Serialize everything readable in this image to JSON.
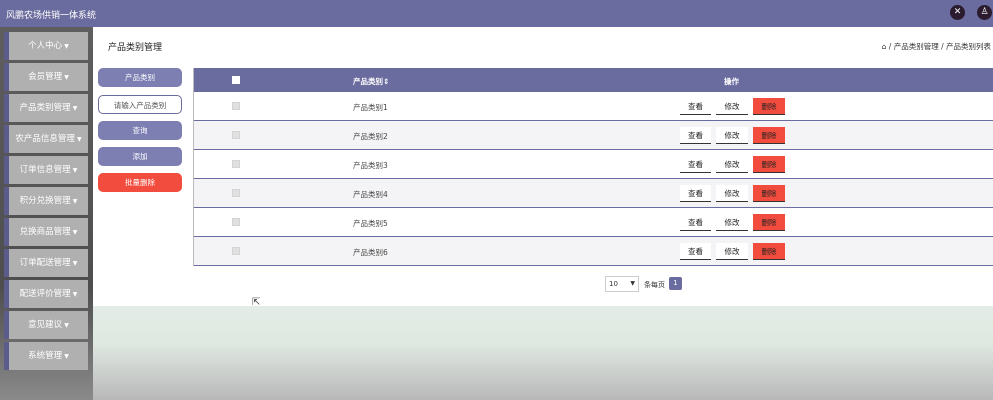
{
  "app": {
    "title": "风鹏农场供销一体系统"
  },
  "topbar": {
    "icons": [
      "fullscreen-exit-icon",
      "user-icon"
    ]
  },
  "sidebar": {
    "items": [
      {
        "label": "个人中心"
      },
      {
        "label": "会员管理"
      },
      {
        "label": "产品类别管理"
      },
      {
        "label": "农产品信息管理"
      },
      {
        "label": "订单信息管理"
      },
      {
        "label": "积分兑换管理"
      },
      {
        "label": "兑换商品管理"
      },
      {
        "label": "订单配送管理"
      },
      {
        "label": "配送评价管理"
      },
      {
        "label": "意见建议"
      },
      {
        "label": "系统管理"
      }
    ]
  },
  "header": {
    "title": "产品类别管理",
    "breadcrumb": "⌂ / 产品类别管理 / 产品类别列表"
  },
  "actions": {
    "field_label": "产品类别",
    "search_placeholder": "请输入产品类别",
    "query_label": "查询",
    "add_label": "添加",
    "batch_delete_label": "批量删除"
  },
  "table": {
    "columns": {
      "name": "产品类别⇕",
      "ops": "操作"
    },
    "rows": [
      {
        "name": "产品类别1"
      },
      {
        "name": "产品类别2"
      },
      {
        "name": "产品类别3"
      },
      {
        "name": "产品类别4"
      },
      {
        "name": "产品类别5"
      },
      {
        "name": "产品类别6"
      }
    ],
    "view_label": "查看",
    "edit_label": "修改",
    "delete_label": "删除"
  },
  "pagination": {
    "page_size": "10",
    "per_page_label": "条每页",
    "current_page": "1"
  },
  "colors": {
    "accent": "#6a6b9e",
    "danger": "#f14c3d",
    "sidebar_item": "#b0b0b0"
  }
}
